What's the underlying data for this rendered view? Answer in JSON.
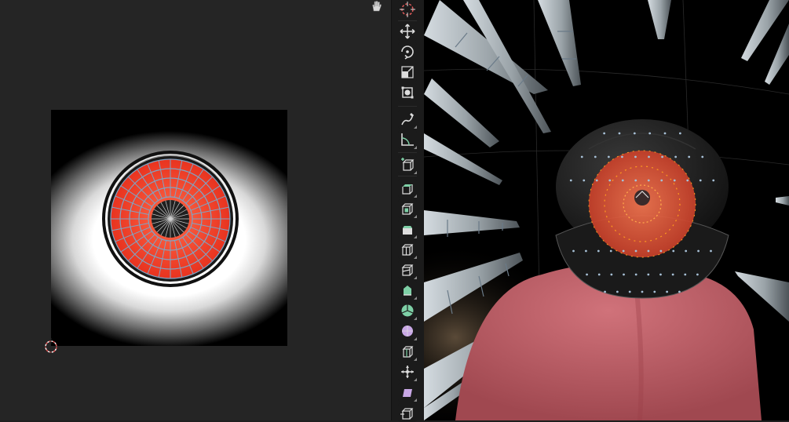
{
  "uv_editor": {
    "image": {
      "subject": "eye-texture"
    },
    "icons": [
      "hand-icon",
      "cursor-icon"
    ]
  },
  "toolbar": {
    "tools": [
      {
        "name": "cursor-tool",
        "icon": "cursor-icon"
      },
      {
        "name": "move-tool",
        "icon": "move-icon"
      },
      {
        "name": "rotate-tool",
        "icon": "rotate-icon"
      },
      {
        "name": "scale-tool",
        "icon": "scale-icon"
      },
      {
        "name": "transform-tool",
        "icon": "transform-icon"
      },
      {
        "name": "annotate-tool",
        "icon": "annotate-icon"
      },
      {
        "name": "measure-tool",
        "icon": "measure-icon"
      },
      {
        "name": "add-cube-tool",
        "icon": "add-cube-icon"
      },
      {
        "name": "extrude-tool",
        "icon": "extrude-icon"
      },
      {
        "name": "inset-tool",
        "icon": "inset-icon"
      },
      {
        "name": "bevel-tool",
        "icon": "bevel-icon"
      },
      {
        "name": "loop-cut-tool",
        "icon": "loop-cut-icon"
      },
      {
        "name": "knife-tool",
        "icon": "knife-icon"
      },
      {
        "name": "poly-build-tool",
        "icon": "poly-build-icon"
      },
      {
        "name": "spin-tool",
        "icon": "spin-icon"
      },
      {
        "name": "smooth-tool",
        "icon": "smooth-icon"
      },
      {
        "name": "edge-slide-tool",
        "icon": "edge-slide-icon"
      },
      {
        "name": "shrink-fatten-tool",
        "icon": "shrink-fatten-icon"
      },
      {
        "name": "shear-tool",
        "icon": "shear-icon"
      },
      {
        "name": "rip-tool",
        "icon": "rip-icon"
      }
    ]
  },
  "viewport": {
    "colors": {
      "iris": "#e8543a",
      "sclera": "#111111",
      "skin": "#c9626c",
      "spike": "#8a9499",
      "vertex": "#a7c0d6",
      "iris_vertex": "#ff9a1f"
    }
  }
}
